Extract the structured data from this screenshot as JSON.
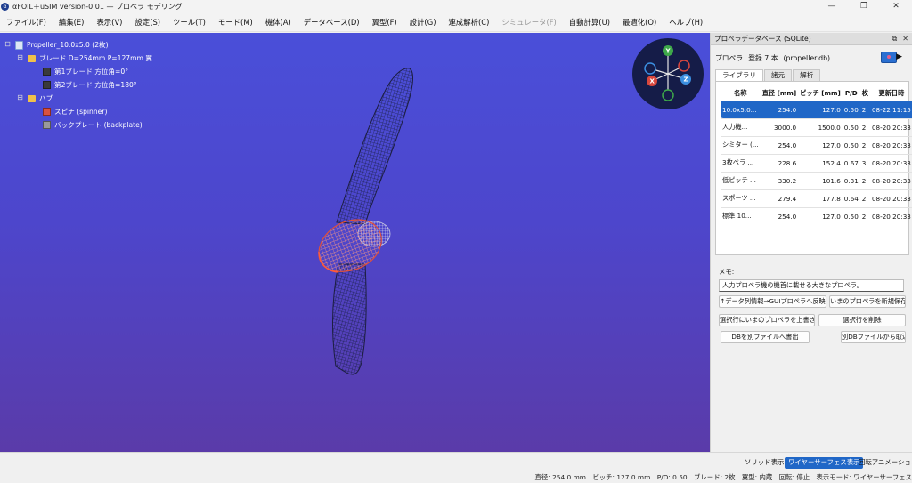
{
  "window": {
    "title": "αFOIL＋uSIM version-0.01 — プロペラ モデリング",
    "controls": [
      "—",
      "❐",
      "✕"
    ]
  },
  "menu": [
    {
      "label": "ファイル(F)",
      "enabled": true
    },
    {
      "label": "編集(E)",
      "enabled": true
    },
    {
      "label": "表示(V)",
      "enabled": true
    },
    {
      "label": "設定(S)",
      "enabled": true
    },
    {
      "label": "ツール(T)",
      "enabled": true
    },
    {
      "label": "モード(M)",
      "enabled": true
    },
    {
      "label": "機体(A)",
      "enabled": true
    },
    {
      "label": "データベース(D)",
      "enabled": true
    },
    {
      "label": "翼型(F)",
      "enabled": true
    },
    {
      "label": "設計(G)",
      "enabled": true
    },
    {
      "label": "連成解析(C)",
      "enabled": true
    },
    {
      "label": "シミュレータ(F)",
      "enabled": false
    },
    {
      "label": "自動計算(U)",
      "enabled": true
    },
    {
      "label": "最適化(O)",
      "enabled": true
    },
    {
      "label": "ヘルプ(H)",
      "enabled": true
    }
  ],
  "tree": {
    "root": "Propeller_10.0x5.0 (2枚)",
    "blade_group": "ブレード D=254mm P=127mm 翼...",
    "blade1": "第1ブレード 方位角=0°",
    "blade2": "第2ブレード 方位角=180°",
    "hub_group": "ハブ",
    "spinner": "スピナ (spinner)",
    "backplate": "バックプレート (backplate)",
    "toggle": "⊟"
  },
  "gizmo": {
    "y": "Y",
    "x": "X",
    "z": "Z"
  },
  "panel": {
    "title": "プロペラデータベース (SQLite)",
    "header_buttons": [
      "⧉",
      "✕"
    ],
    "db_label": "プロペラ",
    "count": "登録 7 本",
    "file": "(propeller.db)",
    "run": "▶",
    "tabs": [
      "ライブラリ",
      "諸元",
      "解析"
    ],
    "table": {
      "headers": [
        "名称",
        "直径 [mm]",
        "ピッチ [mm]",
        "P/D",
        "枚",
        "更新日時"
      ],
      "rows": [
        {
          "name": "10.0x5.0...",
          "diameter": "254.0",
          "pitch": "127.0",
          "pd": "0.50",
          "blades": "2",
          "updated": "08-22 11:15",
          "selected": true
        },
        {
          "name": "人力機...",
          "diameter": "3000.0",
          "pitch": "1500.0",
          "pd": "0.50",
          "blades": "2",
          "updated": "08-20 20:33"
        },
        {
          "name": "シミター (...",
          "diameter": "254.0",
          "pitch": "127.0",
          "pd": "0.50",
          "blades": "2",
          "updated": "08-20 20:33"
        },
        {
          "name": "3枚ペラ ...",
          "diameter": "228.6",
          "pitch": "152.4",
          "pd": "0.67",
          "blades": "3",
          "updated": "08-20 20:33"
        },
        {
          "name": "低ピッチ ...",
          "diameter": "330.2",
          "pitch": "101.6",
          "pd": "0.31",
          "blades": "2",
          "updated": "08-20 20:33"
        },
        {
          "name": "スポーツ ...",
          "diameter": "279.4",
          "pitch": "177.8",
          "pd": "0.64",
          "blades": "2",
          "updated": "08-20 20:33"
        },
        {
          "name": "標準 10...",
          "diameter": "254.0",
          "pitch": "127.0",
          "pd": "0.50",
          "blades": "2",
          "updated": "08-20 20:33"
        }
      ]
    },
    "memo_label": "メモ:",
    "memo_value": "人力プロペラ機の機首に載せる大きなプロペラ。",
    "buttons": {
      "apply_row": "↑データ列情報→GUIプロペラへ反映",
      "save_new": "いまのプロペラを新規保存",
      "overwrite": "選択行にいまのプロペラを上書き",
      "delete": "選択行を削除",
      "export": "DBを別ファイルへ書出",
      "import": "別DBファイルから取込"
    }
  },
  "bottom_toolbar": {
    "solid": "ソリッド表示",
    "wire": "ワイヤーサーフェス表示",
    "anim": "回転アニメーション"
  },
  "status": "直径: 254.0 mm　ピッチ: 127.0 mm　P/D: 0.50　ブレード: 2枚　翼型: 内蔵　回転: 停止　表示モード: ワイヤーサーフェス"
}
